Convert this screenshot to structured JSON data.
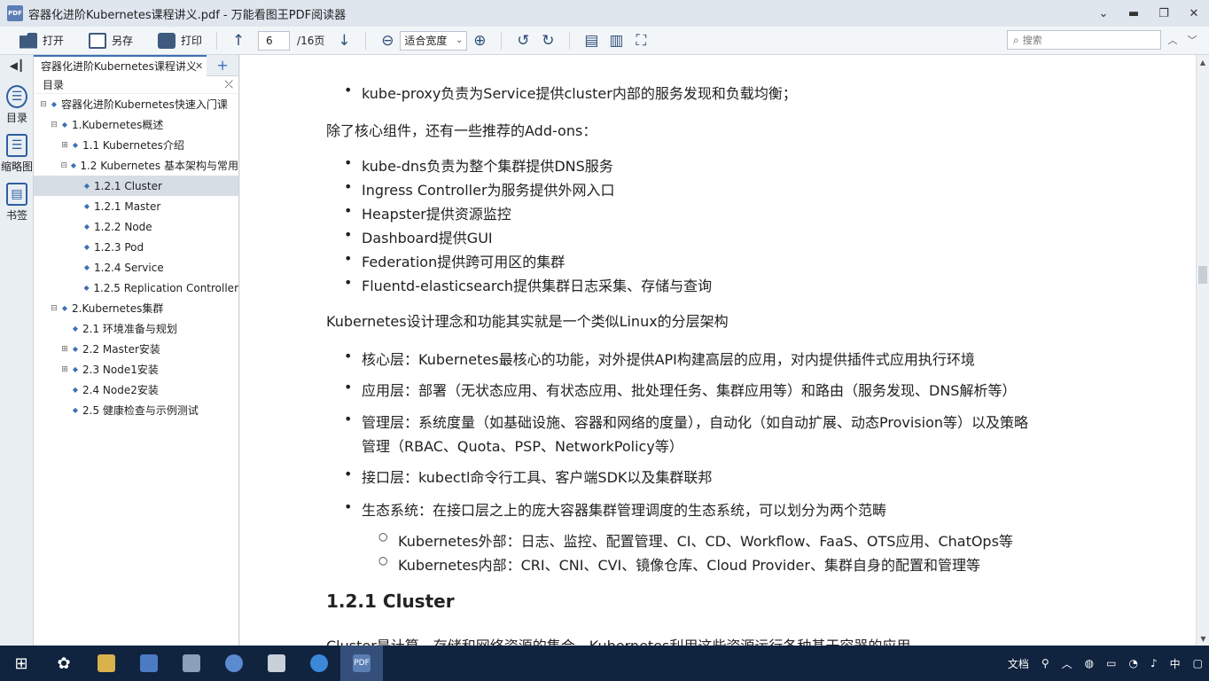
{
  "window": {
    "title": "容器化进阶Kubernetes课程讲义.pdf - 万能看图王PDF阅读器",
    "logo_text": "PDF"
  },
  "toolbar": {
    "open": "打开",
    "save_as": "另存",
    "print": "打印",
    "page_current": "6",
    "page_total": "/16页",
    "zoom": "适合宽度",
    "search_placeholder": "搜索"
  },
  "leftstrip": {
    "toc": "目录",
    "thumbs": "缩略图",
    "bookmarks": "书签"
  },
  "sidebar": {
    "tab_title": "容器化进阶Kubernetes课程讲义",
    "toc_label": "目录",
    "items": [
      {
        "label": "容器化进阶Kubernetes快速入门课",
        "level": 0,
        "exp": "⊟"
      },
      {
        "label": "1.Kubernetes概述",
        "level": 1,
        "exp": "⊟"
      },
      {
        "label": "1.1 Kubernetes介绍",
        "level": 2,
        "exp": "⊞"
      },
      {
        "label": "1.2 Kubernetes 基本架构与常用",
        "level": 2,
        "exp": "⊟"
      },
      {
        "label": "1.2.1 Cluster",
        "level": 3,
        "exp": "",
        "selected": true
      },
      {
        "label": "1.2.1 Master",
        "level": 3,
        "exp": ""
      },
      {
        "label": "1.2.2 Node",
        "level": 3,
        "exp": ""
      },
      {
        "label": "1.2.3 Pod",
        "level": 3,
        "exp": ""
      },
      {
        "label": "1.2.4 Service",
        "level": 3,
        "exp": ""
      },
      {
        "label": "1.2.5 Replication Controller",
        "level": 3,
        "exp": ""
      },
      {
        "label": "2.Kubernetes集群",
        "level": 1,
        "exp": "⊟"
      },
      {
        "label": "2.1 环境准备与规划",
        "level": 2,
        "exp": ""
      },
      {
        "label": "2.2 Master安装",
        "level": 2,
        "exp": "⊞"
      },
      {
        "label": "2.3 Node1安装",
        "level": 2,
        "exp": "⊞"
      },
      {
        "label": "2.4 Node2安装",
        "level": 2,
        "exp": ""
      },
      {
        "label": "2.5 健康检查与示例测试",
        "level": 2,
        "exp": ""
      }
    ]
  },
  "document": {
    "line_kube_proxy": "kube-proxy负责为Service提供cluster内部的服务发现和负载均衡；",
    "addons_intro": "除了核心组件，还有一些推荐的Add-ons：",
    "addons": [
      "kube-dns负责为整个集群提供DNS服务",
      "Ingress Controller为服务提供外网入口",
      "Heapster提供资源监控",
      "Dashboard提供GUI",
      "Federation提供跨可用区的集群",
      "Fluentd-elasticsearch提供集群日志采集、存储与查询"
    ],
    "design_intro": "Kubernetes设计理念和功能其实就是一个类似Linux的分层架构",
    "layers": [
      "核心层：Kubernetes最核心的功能，对外提供API构建高层的应用，对内提供插件式应用执行环境",
      "应用层：部署（无状态应用、有状态应用、批处理任务、集群应用等）和路由（服务发现、DNS解析等）",
      "管理层：系统度量（如基础设施、容器和网络的度量），自动化（如自动扩展、动态Provision等）以及策略",
      "管理（RBAC、Quota、PSP、NetworkPolicy等）",
      "接口层：kubectl命令行工具、客户端SDK以及集群联邦",
      "生态系统：在接口层之上的庞大容器集群管理调度的生态系统，可以划分为两个范畴"
    ],
    "eco": [
      "Kubernetes外部：日志、监控、配置管理、CI、CD、Workflow、FaaS、OTS应用、ChatOps等",
      "Kubernetes内部：CRI、CNI、CVI、镜像仓库、Cloud Provider、集群自身的配置和管理等"
    ],
    "heading": "1.2.1 Cluster",
    "cut_line": "Cluster是计算、存储和网络资源的集合，Kubernetes利用这些资源运行各种基于容器的应用"
  },
  "taskbar": {
    "tray_doc": "文档",
    "ime": "中",
    "pdf_app": "PDF"
  }
}
